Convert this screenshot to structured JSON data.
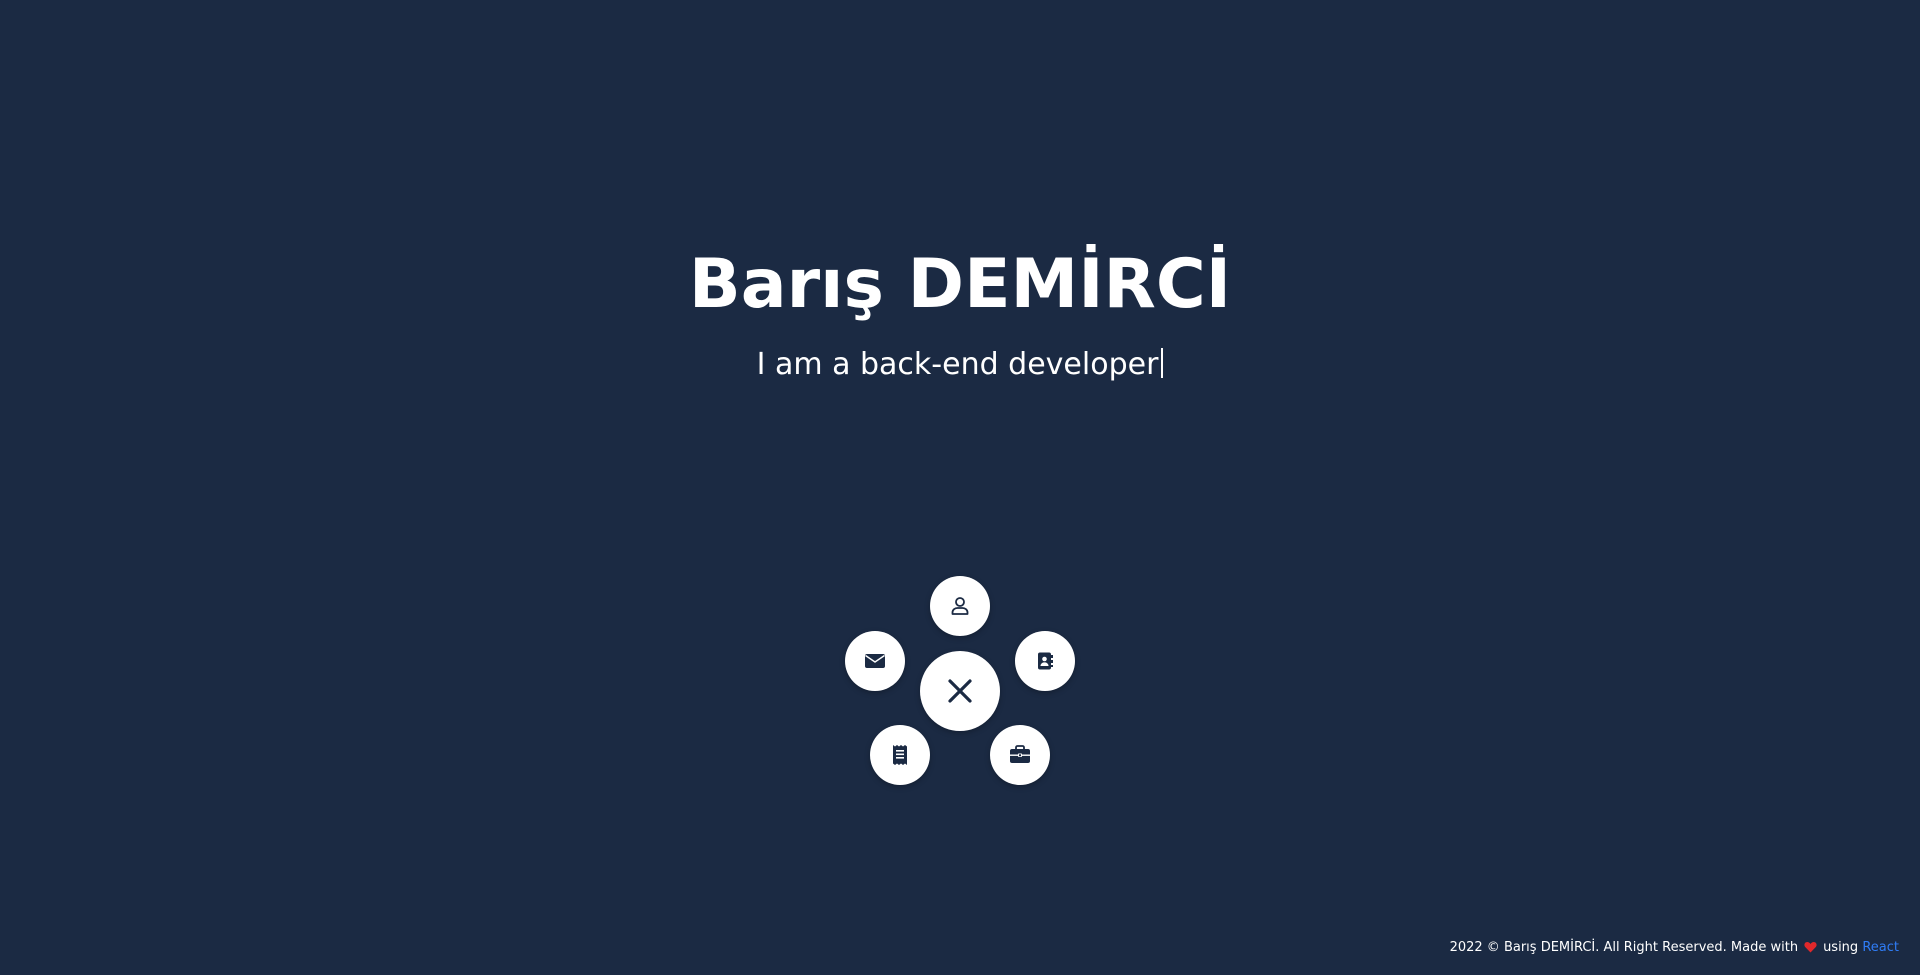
{
  "hero": {
    "name": "Barış DEMİRCİ",
    "subtitle": "I am a back-end developer"
  },
  "fab_menu": {
    "items": [
      {
        "icon": "user-icon"
      },
      {
        "icon": "address-book-icon"
      },
      {
        "icon": "envelope-icon"
      },
      {
        "icon": "receipt-icon"
      },
      {
        "icon": "briefcase-icon"
      }
    ],
    "toggle_icon": "close-icon"
  },
  "footer": {
    "copyright": "2022 © Barış DEMİRCİ. All Right Reserved. Made with",
    "using": "using",
    "link": "React",
    "heart_color": "#e0282b",
    "link_color": "#2f7cf6"
  },
  "colors": {
    "background": "#1b2a43",
    "icon": "#1b2a43",
    "button": "#ffffff"
  }
}
